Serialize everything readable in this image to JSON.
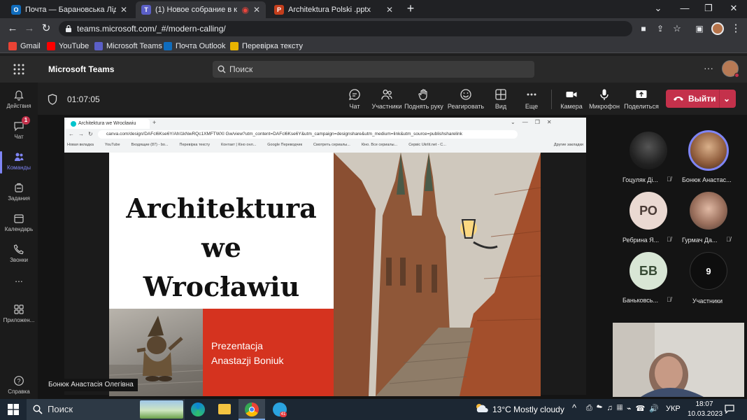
{
  "browser": {
    "tabs": [
      {
        "label": "Почта — Барановська Лідія Вік",
        "icon_color": "#0f6cbd",
        "icon_char": "O"
      },
      {
        "label": "(1) Новое собрание в канал",
        "icon_color": "#5b5fc7",
        "icon_char": "T"
      },
      {
        "label": "Architektura Polski .pptx",
        "icon_color": "#c43e1c",
        "icon_char": "P"
      }
    ],
    "url": "teams.microsoft.com/_#/modern-calling/",
    "bookmarks": [
      {
        "label": "Gmail",
        "color": "#ea4335"
      },
      {
        "label": "YouTube",
        "color": "#ff0000"
      },
      {
        "label": "Microsoft Teams",
        "color": "#5b5fc7"
      },
      {
        "label": "Почта Outlook",
        "color": "#0f6cbd"
      },
      {
        "label": "Перевірка тексту",
        "color": "#e8b400"
      }
    ]
  },
  "teams": {
    "app_title": "Microsoft Teams",
    "search_placeholder": "Поиск",
    "rail": [
      {
        "label": "Действия"
      },
      {
        "label": "Чат",
        "badge": "1"
      },
      {
        "label": "Команды"
      },
      {
        "label": "Задания"
      },
      {
        "label": "Календарь"
      },
      {
        "label": "Звонки"
      },
      {
        "label": "..."
      },
      {
        "label": "Приложен..."
      },
      {
        "label": "Справка"
      }
    ],
    "meeting_timer": "01:07:05",
    "toolbar": [
      {
        "label": "Чат"
      },
      {
        "label": "Участники"
      },
      {
        "label": "Поднять руку"
      },
      {
        "label": "Реагировать"
      },
      {
        "label": "Вид"
      },
      {
        "label": "Еще"
      },
      {
        "label": "Камера"
      },
      {
        "label": "Микрофон"
      },
      {
        "label": "Поделиться"
      }
    ],
    "leave_label": "Выйти",
    "presenter_name": "Бонюк Анастасія Олегівна",
    "participants": [
      {
        "name": "Гоцуляк Ді...",
        "initials": ""
      },
      {
        "name": "Бонюк Анастас...",
        "initials": ""
      },
      {
        "name": "Ребрина Я...",
        "initials": "РО"
      },
      {
        "name": "Гурмач Да...",
        "initials": ""
      },
      {
        "name": "Баньковсь...",
        "initials": "БВ"
      },
      {
        "name": "Участники",
        "initials": "9"
      }
    ]
  },
  "shared_screen": {
    "inner_tab": "Architektura we Wrocławiu",
    "inner_url": "canva.com/design/DAFcl6Kse6Y/AhI1kNwRQc1XMFTWXl Gw/view?utm_content=DAFcl6Kse6Y&utm_campaign=designshare&utm_medium=link&utm_source=publishsharelink",
    "inner_bookmarks": [
      "Новая вкладка",
      "YouTube",
      "Входящие (87) - bo...",
      "Перевірка тексту",
      "Контакт | Кіно онл...",
      "Google Переводчик",
      "Смотреть сериалы...",
      "Кіно. Все сериалы...",
      "Сервіс Ukrlit.net - С...",
      "Другие закладки"
    ],
    "slide_title_lines": [
      "Architektura",
      "we",
      "Wrocławiu"
    ],
    "slide_subtitle_lines": [
      "Prezentacja",
      "Anastazji Boniuk"
    ],
    "accent_color": "#d5331f"
  },
  "taskbar": {
    "search_label": "Поиск",
    "weather": "13°C  Mostly cloudy",
    "lang": "УКР",
    "time": "18:07",
    "date": "10.03.2023"
  }
}
